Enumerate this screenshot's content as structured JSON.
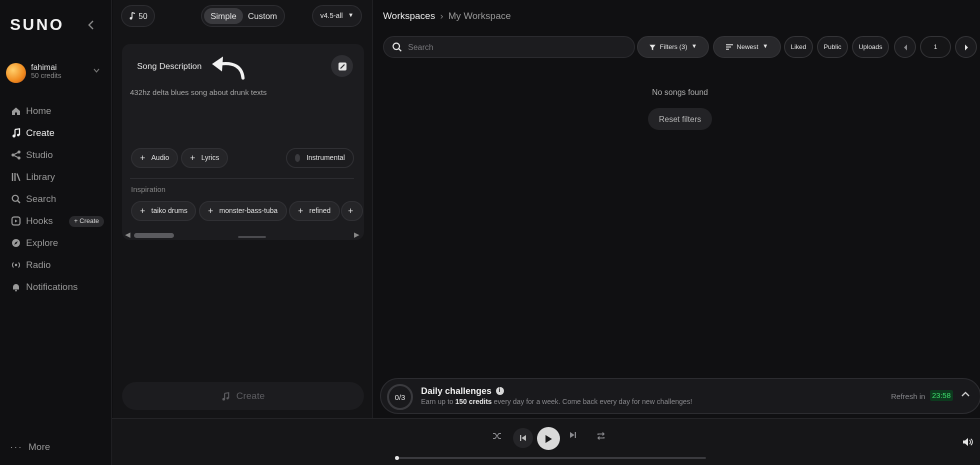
{
  "sidebar": {
    "logo": "SUNO",
    "profile": {
      "name": "fahimai",
      "credits": "50 credits"
    },
    "nav": [
      {
        "label": "Home",
        "icon": "home-icon"
      },
      {
        "label": "Create",
        "icon": "music-note-icon"
      },
      {
        "label": "Studio",
        "icon": "studio-icon"
      },
      {
        "label": "Library",
        "icon": "library-icon"
      },
      {
        "label": "Search",
        "icon": "search-icon"
      },
      {
        "label": "Hooks",
        "icon": "hooks-icon",
        "badge": "+ Create"
      },
      {
        "label": "Explore",
        "icon": "compass-icon"
      },
      {
        "label": "Radio",
        "icon": "radio-icon"
      },
      {
        "label": "Notifications",
        "icon": "bell-icon"
      }
    ],
    "more": "More"
  },
  "create_panel": {
    "notes_count": "50",
    "modes": [
      "Simple",
      "Custom"
    ],
    "active_mode": "Simple",
    "version": "v4.5-all",
    "song_description_label": "Song Description",
    "description": "432hz delta blues song about drunk texts",
    "chips": {
      "audio": "Audio",
      "lyrics": "Lyrics",
      "instrumental": "Instrumental"
    },
    "inspiration_label": "Inspiration",
    "inspiration_tags": [
      "taiko drums",
      "monster-bass-tuba",
      "refined",
      ""
    ],
    "create_label": "Create"
  },
  "workspace": {
    "breadcrumb": {
      "root": "Workspaces",
      "current": "My Workspace"
    },
    "search_placeholder": "Search",
    "filters": {
      "filters": "Filters (3)",
      "sort": "Newest",
      "liked": "Liked",
      "public": "Public",
      "uploads": "Uploads"
    },
    "page": "1",
    "empty_message": "No songs found",
    "reset_label": "Reset filters",
    "challenge": {
      "progress": "0/3",
      "title": "Daily challenges",
      "subtitle_pre": "Earn up to ",
      "subtitle_bold": "150 credits",
      "subtitle_post": " every day for a week. Come back every day for new challenges!",
      "refresh_label": "Refresh in",
      "timer": "23:58"
    }
  },
  "colors": {
    "background": "#101012",
    "timer_green": "#3ee06d",
    "avatar_orange": "#f08a1e"
  }
}
